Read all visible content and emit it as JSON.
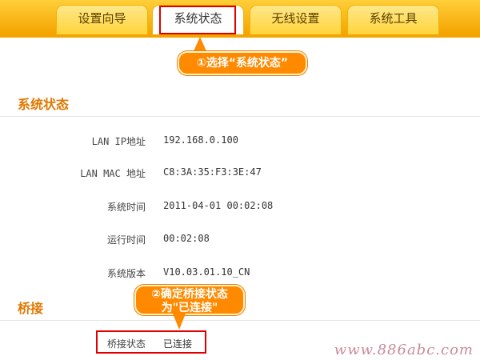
{
  "tabs": [
    "设置向导",
    "系统状态",
    "无线设置",
    "系统工具"
  ],
  "callouts": {
    "step1": "①选择“系统状态”",
    "step2_line1": "②确定桥接状态",
    "step2_line2": "为\"已连接\""
  },
  "status": {
    "title": "系统状态",
    "rows": [
      {
        "label": "LAN IP地址",
        "value": "192.168.0.100"
      },
      {
        "label": "LAN MAC 地址",
        "value": "C8:3A:35:F3:3E:47"
      },
      {
        "label": "系统时间",
        "value": "2011-04-01 00:02:08"
      },
      {
        "label": "运行时间",
        "value": "00:02:08"
      },
      {
        "label": "系统版本",
        "value": "V10.03.01.10_CN"
      }
    ]
  },
  "bridge": {
    "title": "桥接",
    "label": "桥接状态",
    "value": "已连接"
  },
  "watermark": "www.886abc.com",
  "colors": {
    "accent": "#f4a400",
    "highlight": "#e00000",
    "section_title": "#e07800",
    "callout": "#ff8a00"
  }
}
